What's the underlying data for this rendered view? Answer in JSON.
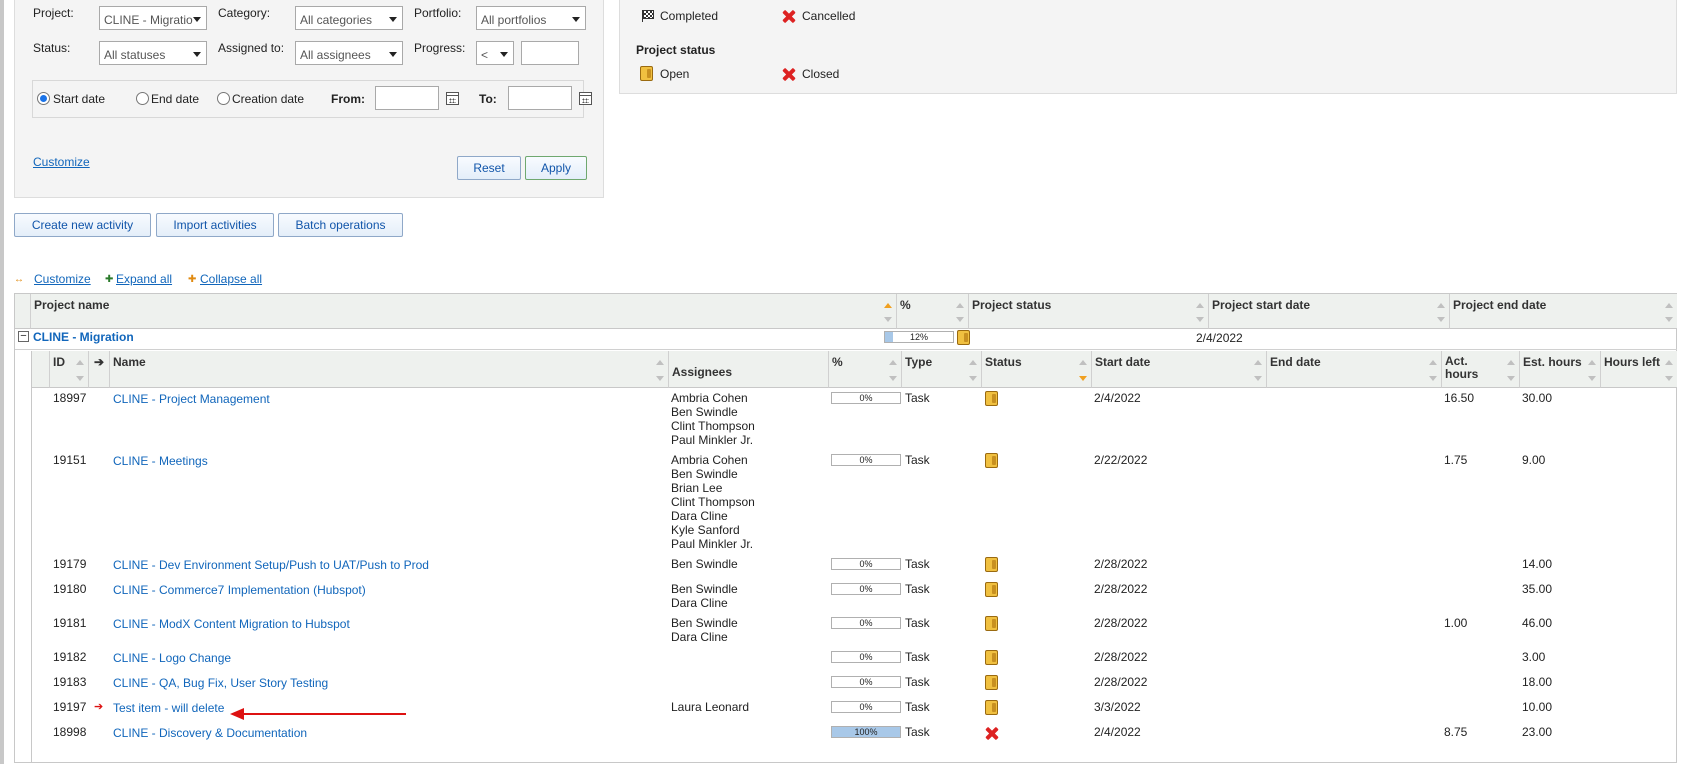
{
  "filters": {
    "project_label": "Project:",
    "project_value": "CLINE - Migratio",
    "category_label": "Category:",
    "category_value": "All categories",
    "portfolio_label": "Portfolio:",
    "portfolio_value": "All portfolios",
    "status_label": "Status:",
    "status_value": "All statuses",
    "assigned_label": "Assigned to:",
    "assigned_value": "All assignees",
    "progress_label": "Progress:",
    "progress_op": "<",
    "date_options": [
      "Start date",
      "End date",
      "Creation date"
    ],
    "date_selected": "Start date",
    "from_label": "From:",
    "to_label": "To:",
    "customize_link": "Customize",
    "reset_label": "Reset",
    "apply_label": "Apply"
  },
  "legend": {
    "completed_label": "Completed",
    "cancelled_label": "Cancelled",
    "project_status_title": "Project status",
    "open_label": "Open",
    "closed_label": "Closed"
  },
  "actions": {
    "create_label": "Create new activity",
    "import_label": "Import activities",
    "batch_label": "Batch operations"
  },
  "view_links": {
    "customize": "Customize",
    "expand_all": "Expand all",
    "collapse_all": "Collapse all"
  },
  "project_table": {
    "headers": {
      "name": "Project name",
      "percent": "%",
      "status": "Project status",
      "start": "Project start date",
      "end": "Project end date"
    },
    "project": {
      "name": "CLINE - Migration",
      "percent": "12%",
      "percent_value": 12,
      "status_icon": "open-status-icon",
      "start": "2/4/2022",
      "end": ""
    }
  },
  "activity_table": {
    "headers": {
      "id": "ID",
      "name": "Name",
      "assignees": "Assignees",
      "percent": "%",
      "type": "Type",
      "status": "Status",
      "start": "Start date",
      "end": "End date",
      "act_hours": "Act. hours",
      "est_hours": "Est. hours",
      "hours_left": "Hours left"
    },
    "rows": [
      {
        "id": "18997",
        "name": "CLINE - Project Management",
        "assignees": [
          "Ambria Cohen",
          "Ben Swindle",
          "Clint Thompson",
          "Paul Minkler Jr."
        ],
        "percent": "0%",
        "percent_value": 0,
        "type": "Task",
        "status": "open",
        "start": "2/4/2022",
        "end": "",
        "act": "16.50",
        "est": "30.00",
        "left": ""
      },
      {
        "id": "19151",
        "name": "CLINE - Meetings",
        "assignees": [
          "Ambria Cohen",
          "Ben Swindle",
          "Brian Lee",
          "Clint Thompson",
          "Dara Cline",
          "Kyle Sanford",
          "Paul Minkler Jr."
        ],
        "percent": "0%",
        "percent_value": 0,
        "type": "Task",
        "status": "open",
        "start": "2/22/2022",
        "end": "",
        "act": "1.75",
        "est": "9.00",
        "left": ""
      },
      {
        "id": "19179",
        "name": "CLINE - Dev Environment Setup/Push to UAT/Push to Prod",
        "assignees": [
          "Ben Swindle"
        ],
        "percent": "0%",
        "percent_value": 0,
        "type": "Task",
        "status": "open",
        "start": "2/28/2022",
        "end": "",
        "act": "",
        "est": "14.00",
        "left": ""
      },
      {
        "id": "19180",
        "name": "CLINE - Commerce7 Implementation (Hubspot)",
        "assignees": [
          "Ben Swindle",
          "Dara Cline"
        ],
        "percent": "0%",
        "percent_value": 0,
        "type": "Task",
        "status": "open",
        "start": "2/28/2022",
        "end": "",
        "act": "",
        "est": "35.00",
        "left": ""
      },
      {
        "id": "19181",
        "name": "CLINE - ModX Content Migration to Hubspot",
        "assignees": [
          "Ben Swindle",
          "Dara Cline"
        ],
        "percent": "0%",
        "percent_value": 0,
        "type": "Task",
        "status": "open",
        "start": "2/28/2022",
        "end": "",
        "act": "1.00",
        "est": "46.00",
        "left": ""
      },
      {
        "id": "19182",
        "name": "CLINE - Logo Change",
        "assignees": [],
        "percent": "0%",
        "percent_value": 0,
        "type": "Task",
        "status": "open",
        "start": "2/28/2022",
        "end": "",
        "act": "",
        "est": "3.00",
        "left": ""
      },
      {
        "id": "19183",
        "name": "CLINE - QA, Bug Fix, User Story Testing",
        "assignees": [],
        "percent": "0%",
        "percent_value": 0,
        "type": "Task",
        "status": "open",
        "start": "2/28/2022",
        "end": "",
        "act": "",
        "est": "18.00",
        "left": ""
      },
      {
        "id": "19197",
        "name": "Test item - will delete",
        "assignees": [
          "Laura Leonard"
        ],
        "percent": "0%",
        "percent_value": 0,
        "type": "Task",
        "status": "open",
        "start": "3/3/2022",
        "end": "",
        "act": "",
        "est": "10.00",
        "left": ""
      },
      {
        "id": "18998",
        "name": "CLINE - Discovery & Documentation",
        "assignees": [],
        "percent": "100%",
        "percent_value": 100,
        "type": "Task",
        "status": "cancelled",
        "start": "2/4/2022",
        "end": "",
        "act": "8.75",
        "est": "23.00",
        "left": ""
      }
    ]
  },
  "colors": {
    "link": "#1166bb",
    "progress_fill": "#a8c8e8",
    "cancelled": "#dd2222",
    "open_status": "#f0c040",
    "annotation_arrow": "#dd1111"
  }
}
